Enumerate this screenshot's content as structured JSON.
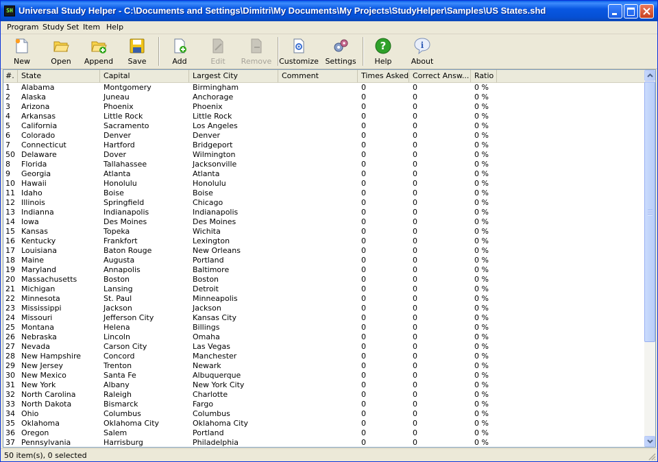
{
  "window": {
    "title": "Universal Study Helper - C:\\Documents and Settings\\Dimitri\\My Documents\\My Projects\\StudyHelper\\Samples\\US States.shd",
    "icon_text": "SH"
  },
  "menu": [
    "Program",
    "Study Set",
    "Item",
    "Help"
  ],
  "toolbar": {
    "new": "New",
    "open": "Open",
    "append": "Append",
    "save": "Save",
    "add": "Add",
    "edit": "Edit",
    "remove": "Remove",
    "customize": "Customize",
    "settings": "Settings",
    "help": "Help",
    "about": "About"
  },
  "table": {
    "headers": [
      "#.",
      "State",
      "Capital",
      "Largest City",
      "Comment",
      "Times Asked",
      "Correct Answ...",
      "Ratio"
    ],
    "rows": [
      [
        "1",
        "Alabama",
        "Montgomery",
        "Birmingham",
        "",
        "0",
        "0",
        "0 %"
      ],
      [
        "2",
        "Alaska",
        "Juneau",
        "Anchorage",
        "",
        "0",
        "0",
        "0 %"
      ],
      [
        "3",
        "Arizona",
        "Phoenix",
        "Phoenix",
        "",
        "0",
        "0",
        "0 %"
      ],
      [
        "4",
        "Arkansas",
        "Little Rock",
        "Little Rock",
        "",
        "0",
        "0",
        "0 %"
      ],
      [
        "5",
        "California",
        "Sacramento",
        "Los Angeles",
        "",
        "0",
        "0",
        "0 %"
      ],
      [
        "6",
        "Colorado",
        "Denver",
        "Denver",
        "",
        "0",
        "0",
        "0 %"
      ],
      [
        "7",
        "Connecticut",
        "Hartford",
        "Bridgeport",
        "",
        "0",
        "0",
        "0 %"
      ],
      [
        "50",
        "Delaware",
        "Dover",
        "Wilmington",
        "",
        "0",
        "0",
        "0 %"
      ],
      [
        "8",
        "Florida",
        "Tallahassee",
        "Jacksonville",
        "",
        "0",
        "0",
        "0 %"
      ],
      [
        "9",
        "Georgia",
        "Atlanta",
        "Atlanta",
        "",
        "0",
        "0",
        "0 %"
      ],
      [
        "10",
        "Hawaii",
        "Honolulu",
        "Honolulu",
        "",
        "0",
        "0",
        "0 %"
      ],
      [
        "11",
        "Idaho",
        "Boise",
        "Boise",
        "",
        "0",
        "0",
        "0 %"
      ],
      [
        "12",
        "Illinois",
        "Springfield",
        "Chicago",
        "",
        "0",
        "0",
        "0 %"
      ],
      [
        "13",
        "Indianna",
        "Indianapolis",
        "Indianapolis",
        "",
        "0",
        "0",
        "0 %"
      ],
      [
        "14",
        "Iowa",
        "Des Moines",
        "Des Moines",
        "",
        "0",
        "0",
        "0 %"
      ],
      [
        "15",
        "Kansas",
        "Topeka",
        "Wichita",
        "",
        "0",
        "0",
        "0 %"
      ],
      [
        "16",
        "Kentucky",
        "Frankfort",
        "Lexington",
        "",
        "0",
        "0",
        "0 %"
      ],
      [
        "17",
        "Louisiana",
        "Baton Rouge",
        "New Orleans",
        "",
        "0",
        "0",
        "0 %"
      ],
      [
        "18",
        "Maine",
        "Augusta",
        "Portland",
        "",
        "0",
        "0",
        "0 %"
      ],
      [
        "19",
        "Maryland",
        "Annapolis",
        "Baltimore",
        "",
        "0",
        "0",
        "0 %"
      ],
      [
        "20",
        "Massachusetts",
        "Boston",
        "Boston",
        "",
        "0",
        "0",
        "0 %"
      ],
      [
        "21",
        "Michigan",
        "Lansing",
        "Detroit",
        "",
        "0",
        "0",
        "0 %"
      ],
      [
        "22",
        "Minnesota",
        "St. Paul",
        "Minneapolis",
        "",
        "0",
        "0",
        "0 %"
      ],
      [
        "23",
        "Mississippi",
        "Jackson",
        "Jackson",
        "",
        "0",
        "0",
        "0 %"
      ],
      [
        "24",
        "Missouri",
        "Jefferson City",
        "Kansas City",
        "",
        "0",
        "0",
        "0 %"
      ],
      [
        "25",
        "Montana",
        "Helena",
        "Billings",
        "",
        "0",
        "0",
        "0 %"
      ],
      [
        "26",
        "Nebraska",
        "Lincoln",
        "Omaha",
        "",
        "0",
        "0",
        "0 %"
      ],
      [
        "27",
        "Nevada",
        "Carson City",
        "Las Vegas",
        "",
        "0",
        "0",
        "0 %"
      ],
      [
        "28",
        "New Hampshire",
        "Concord",
        "Manchester",
        "",
        "0",
        "0",
        "0 %"
      ],
      [
        "29",
        "New Jersey",
        "Trenton",
        "Newark",
        "",
        "0",
        "0",
        "0 %"
      ],
      [
        "30",
        "New Mexico",
        "Santa Fe",
        "Albuquerque",
        "",
        "0",
        "0",
        "0 %"
      ],
      [
        "31",
        "New York",
        "Albany",
        "New York City",
        "",
        "0",
        "0",
        "0 %"
      ],
      [
        "32",
        "North Carolina",
        "Raleigh",
        "Charlotte",
        "",
        "0",
        "0",
        "0 %"
      ],
      [
        "33",
        "North Dakota",
        "Bismarck",
        "Fargo",
        "",
        "0",
        "0",
        "0 %"
      ],
      [
        "34",
        "Ohio",
        "Columbus",
        "Columbus",
        "",
        "0",
        "0",
        "0 %"
      ],
      [
        "35",
        "Oklahoma",
        "Oklahoma City",
        "Oklahoma City",
        "",
        "0",
        "0",
        "0 %"
      ],
      [
        "36",
        "Oregon",
        "Salem",
        "Portland",
        "",
        "0",
        "0",
        "0 %"
      ],
      [
        "37",
        "Pennsylvania",
        "Harrisburg",
        "Philadelphia",
        "",
        "0",
        "0",
        "0 %"
      ]
    ]
  },
  "status": {
    "text": "50 item(s), 0 selected"
  },
  "colors": {
    "titlebar": "#0857e2",
    "face": "#ece9d8",
    "list_border": "#7f9db9"
  }
}
